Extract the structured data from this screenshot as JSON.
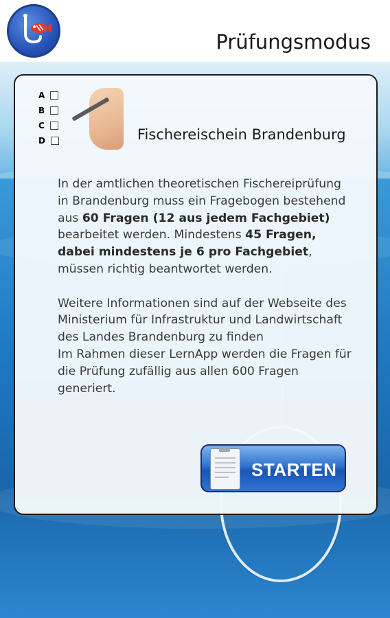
{
  "header": {
    "title": "Prüfungsmodus",
    "logo_icon": "fishing-hook-fish-logo-icon"
  },
  "card": {
    "heading": "Fischereischein Brandenburg",
    "illustration": {
      "icon": "checklist-with-pencil-icon",
      "options": [
        "A",
        "B",
        "C",
        "D"
      ]
    },
    "paragraph1": {
      "t1": "In der amtlichen theoretischen Fischereiprüfung in Brandenburg muss ein Fragebogen bestehend aus ",
      "b1": "60 Fragen (12 aus jedem Fachgebiet)",
      "t2": " bearbeitet werden. Mindestens ",
      "b2": "45 Fragen, dabei mindestens je 6 pro Fachgebiet",
      "t3": ", müssen richtig beantwortet werden."
    },
    "paragraph2": "Weitere Informationen sind auf der Webseite des Ministerium für Infrastruktur und Landwirtschaft des Landes Brandenburg zu finden",
    "paragraph3": "Im Rahmen dieser LernApp werden die Fragen für die Prüfung zufällig aus allen 600 Fragen generiert.",
    "start_button": {
      "label": "STARTEN",
      "icon": "clipboard-document-icon"
    }
  },
  "colors": {
    "button_blue": "#2f73d0",
    "logo_blue": "#2654b8",
    "water_blue": "#1f78c2"
  }
}
